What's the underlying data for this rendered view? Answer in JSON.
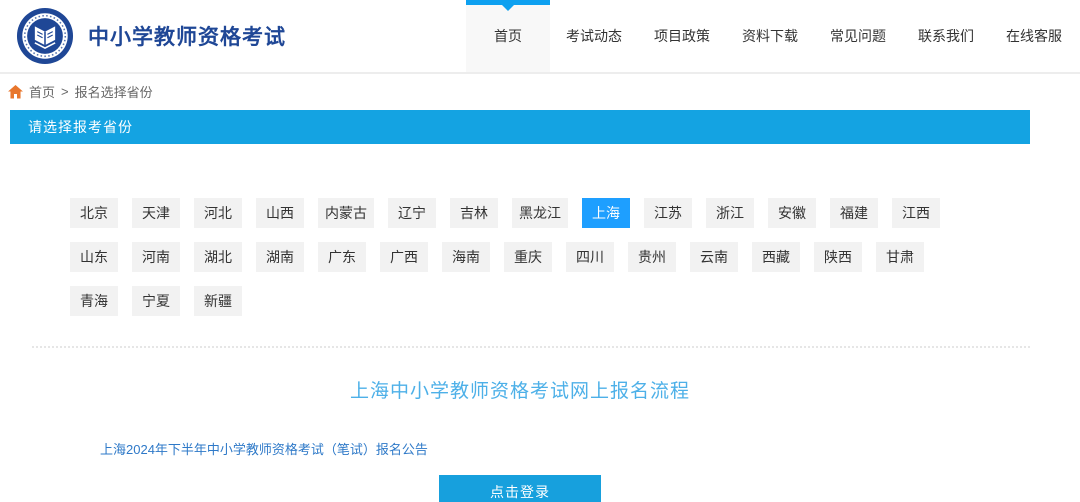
{
  "header": {
    "logo": {
      "icon": "book-seal-logo",
      "title": "中小学教师资格考试"
    },
    "nav": [
      {
        "label": "首页",
        "active": true
      },
      {
        "label": "考试动态",
        "active": false
      },
      {
        "label": "项目政策",
        "active": false
      },
      {
        "label": "资料下载",
        "active": false
      },
      {
        "label": "常见问题",
        "active": false
      },
      {
        "label": "联系我们",
        "active": false
      },
      {
        "label": "在线客服",
        "active": false
      }
    ]
  },
  "breadcrumb": {
    "home_icon": "home-icon",
    "home": "首页",
    "separator": ">",
    "current": "报名选择省份"
  },
  "banner": {
    "text": "请选择报考省份"
  },
  "provinces": {
    "selected": "上海",
    "rows": [
      [
        "北京",
        "天津",
        "河北",
        "山西",
        "内蒙古",
        "辽宁",
        "吉林",
        "黑龙江",
        "上海",
        "江苏",
        "浙江",
        "安徽",
        "福建",
        "江西"
      ],
      [
        "山东",
        "河南",
        "湖北",
        "湖南",
        "广东",
        "广西",
        "海南",
        "重庆",
        "四川",
        "贵州",
        "云南",
        "西藏",
        "陕西",
        "甘肃"
      ],
      [
        "青海",
        "宁夏",
        "新疆"
      ]
    ]
  },
  "main": {
    "flow_title": "上海中小学教师资格考试网上报名流程",
    "announcement_link": "上海2024年下半年中小学教师资格考试（笔试）报名公告",
    "login_button": "点击登录"
  },
  "colors": {
    "accent": "#14a3e2",
    "selected-blue": "#1e9fff",
    "tab-blue": "#0da0f0",
    "navy": "#1f4796",
    "title-blue": "#4db0e8",
    "link-blue": "#2e79c8",
    "orange": "#e8762c",
    "btn-blue": "#17a0dd"
  }
}
